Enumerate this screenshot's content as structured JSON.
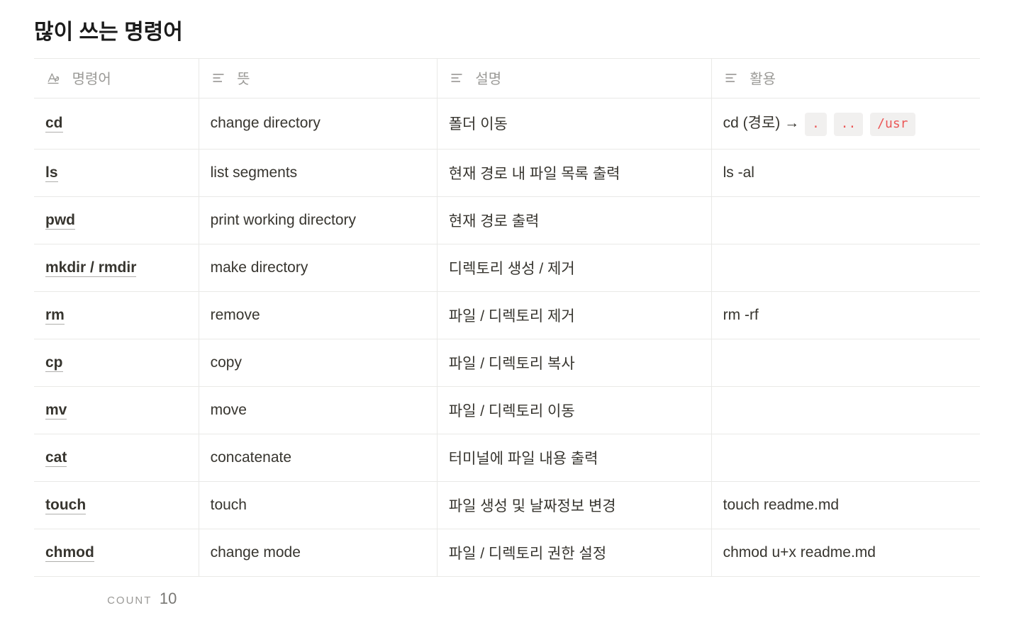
{
  "title": "많이 쓰는 명령어",
  "columns": {
    "c0": "명령어",
    "c1": "뜻",
    "c2": "설명",
    "c3": "활용"
  },
  "rows": [
    {
      "cmd": "cd",
      "meaning": "change directory",
      "desc": "폴더 이동",
      "usage_prefix": "cd (경로) →",
      "usage_chips": [
        ".",
        "..",
        "/usr"
      ]
    },
    {
      "cmd": "ls",
      "meaning": "list segments",
      "desc": "현재 경로 내 파일 목록 출력",
      "usage_text": "ls -al"
    },
    {
      "cmd": "pwd",
      "meaning": "print working directory",
      "desc": "현재 경로 출력",
      "usage_text": ""
    },
    {
      "cmd": "mkdir / rmdir",
      "meaning": "make directory",
      "desc": "디렉토리 생성 / 제거",
      "usage_text": ""
    },
    {
      "cmd": "rm",
      "meaning": "remove",
      "desc": "파일 / 디렉토리 제거",
      "usage_text": "rm -rf"
    },
    {
      "cmd": "cp",
      "meaning": "copy",
      "desc": "파일 / 디렉토리 복사",
      "usage_text": ""
    },
    {
      "cmd": "mv",
      "meaning": "move",
      "desc": "파일 / 디렉토리 이동",
      "usage_text": ""
    },
    {
      "cmd": "cat",
      "meaning": "concatenate",
      "desc": "터미널에 파일 내용 출력",
      "usage_text": ""
    },
    {
      "cmd": "touch",
      "meaning": "touch",
      "desc": "파일 생성 및 날짜정보 변경",
      "usage_text": "touch readme.md"
    },
    {
      "cmd": "chmod",
      "meaning": "change mode",
      "desc": "파일 / 디렉토리 권한 설정",
      "usage_text": "chmod u+x readme.md"
    }
  ],
  "footer": {
    "count_label": "COUNT",
    "count_value": "10"
  }
}
